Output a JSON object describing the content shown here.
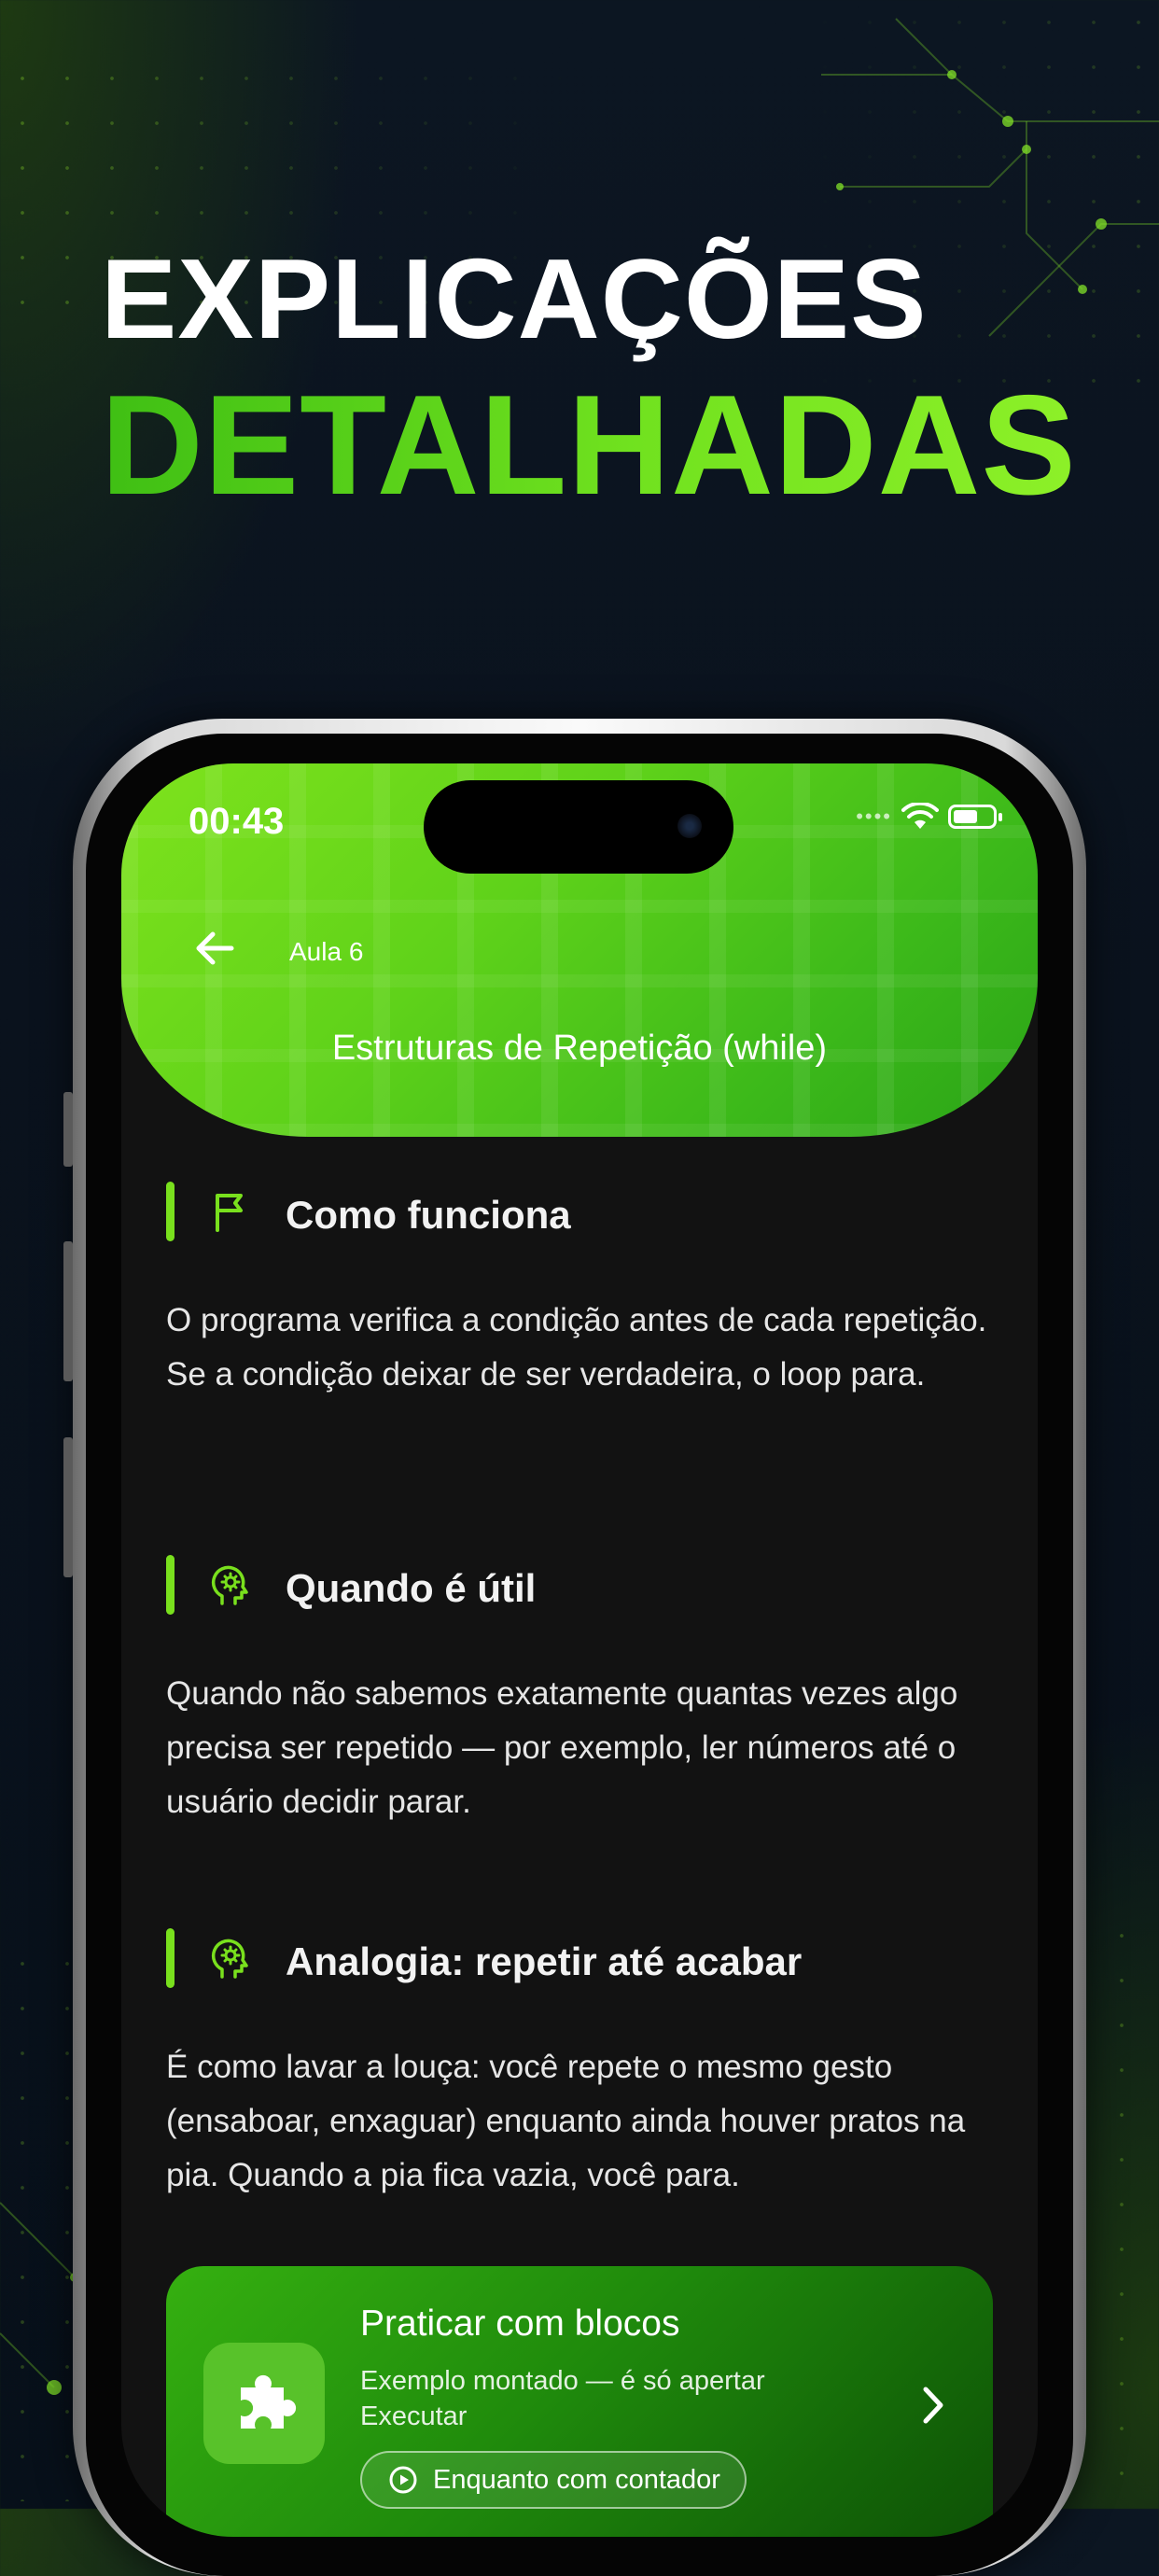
{
  "headline": {
    "line1": "EXPLICAÇÕES",
    "line2": "DETALHADAS"
  },
  "status_bar": {
    "time": "00:43"
  },
  "header": {
    "back_icon": "arrow-left-icon",
    "subtitle": "Aula 6",
    "title": "Estruturas de Repetição (while)"
  },
  "sections": [
    {
      "icon": "flag-icon",
      "title": "Como funciona",
      "body": "O programa verifica a condição antes de cada repetição. Se a condição deixar de ser verdadeira, o loop para."
    },
    {
      "icon": "head-gear-icon",
      "title": "Quando é útil",
      "body": "Quando não sabemos exatamente quantas vezes algo precisa ser repetido — por exemplo, ler números até o usuário decidir parar."
    },
    {
      "icon": "head-gear-icon",
      "title": "Analogia: repetir até acabar",
      "body": "É como lavar a louça: você repete o mesmo gesto (ensaboar, enxaguar) enquanto ainda houver pratos na pia. Quando a pia fica vazia, você para."
    }
  ],
  "practice_card": {
    "icon": "puzzle-icon",
    "title": "Praticar com blocos",
    "subtitle": "Exemplo montado — é só apertar Executar",
    "chip_icon": "play-circle-icon",
    "chip_label": "Enquanto com contador",
    "chevron_icon": "chevron-right-icon"
  },
  "colors": {
    "accent": "#79e01d",
    "background": "#0a121d",
    "screen": "#121212",
    "headline_green": "#5fd21a"
  }
}
